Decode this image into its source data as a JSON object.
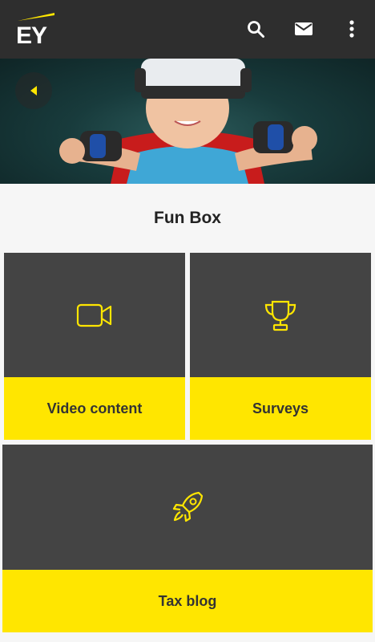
{
  "brand": {
    "logo_text": "EY",
    "accent_color": "#ffe600",
    "bar_color": "#2e2e2e",
    "tile_color": "#444444"
  },
  "appbar": {
    "icons": [
      "search-icon",
      "mail-icon",
      "more-vert-icon"
    ]
  },
  "hero": {
    "image": "child-wearing-vr-headset-and-red-cape"
  },
  "page": {
    "title": "Fun Box"
  },
  "tiles": [
    {
      "label": "Video content",
      "icon": "video-camera-icon"
    },
    {
      "label": "Surveys",
      "icon": "trophy-icon"
    },
    {
      "label": "Tax blog",
      "icon": "rocket-icon"
    }
  ]
}
